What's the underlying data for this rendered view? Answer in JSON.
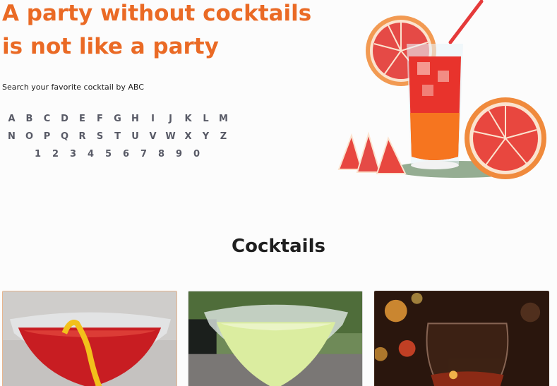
{
  "hero": {
    "title_line1": "A party without cocktails",
    "title_line2": "is not like a party",
    "search_label": "Search your favorite cocktail by ABC",
    "accent_color": "#ea6a25"
  },
  "alphabet": {
    "row1": [
      "A",
      "B",
      "C",
      "D",
      "E",
      "F",
      "G",
      "H",
      "I",
      "J",
      "K",
      "L",
      "M"
    ],
    "row2": [
      "N",
      "O",
      "P",
      "Q",
      "R",
      "S",
      "T",
      "U",
      "V",
      "W",
      "X",
      "Y",
      "Z"
    ],
    "row3": [
      "1",
      "2",
      "3",
      "4",
      "5",
      "6",
      "7",
      "8",
      "9",
      "0"
    ]
  },
  "section": {
    "title": "Cocktails"
  },
  "cards": [
    {
      "image": "red-martini-with-lemon-twist"
    },
    {
      "image": "green-margarita-cocktail"
    },
    {
      "image": "brandy-snifter-bokeh"
    }
  ]
}
